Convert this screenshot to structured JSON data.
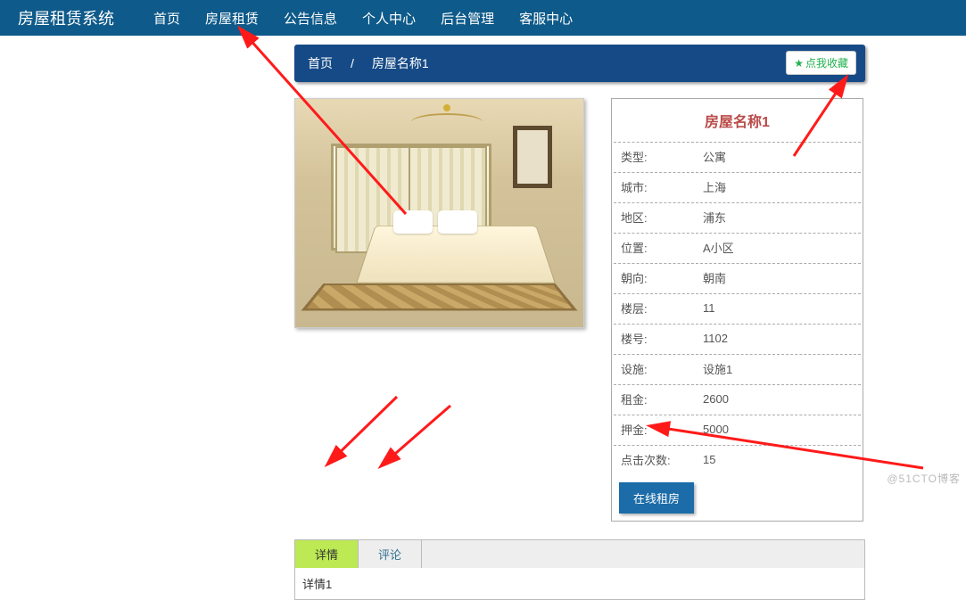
{
  "nav": {
    "brand": "房屋租赁系统",
    "items": [
      "首页",
      "房屋租赁",
      "公告信息",
      "个人中心",
      "后台管理",
      "客服中心"
    ]
  },
  "breadcrumb": {
    "home": "首页",
    "sep": "/",
    "current": "房屋名称1"
  },
  "favorite": {
    "star": "★",
    "label": "点我收藏"
  },
  "detail": {
    "title": "房屋名称1",
    "rows": [
      {
        "label": "类型:",
        "value": "公寓"
      },
      {
        "label": "城市:",
        "value": "上海"
      },
      {
        "label": "地区:",
        "value": "浦东"
      },
      {
        "label": "位置:",
        "value": "A小区"
      },
      {
        "label": "朝向:",
        "value": "朝南"
      },
      {
        "label": "楼层:",
        "value": "11"
      },
      {
        "label": "楼号:",
        "value": "1102"
      },
      {
        "label": "设施:",
        "value": "设施1"
      },
      {
        "label": "租金:",
        "value": "2600"
      },
      {
        "label": "押金:",
        "value": "5000"
      },
      {
        "label": "点击次数:",
        "value": "15"
      }
    ],
    "online_btn": "在线租房"
  },
  "tabs": {
    "detail": "详情",
    "comment": "评论",
    "body": "详情1"
  },
  "watermark": "@51CTO博客",
  "colors": {
    "nav": "#0e5a8a",
    "crumb": "#154a86",
    "accent": "#22b24c",
    "title": "#b94a48",
    "button": "#1b6ca8",
    "tab_active": "#bce954"
  }
}
